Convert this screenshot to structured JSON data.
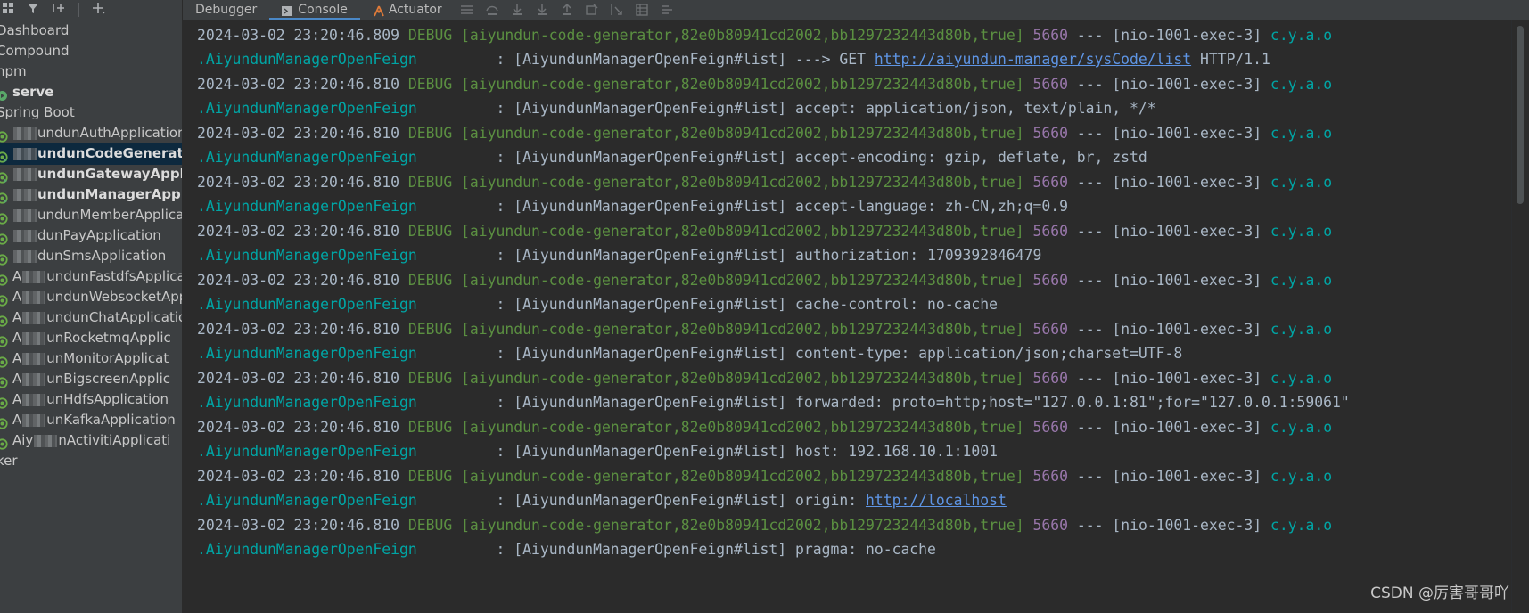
{
  "colors": {
    "timestamp": "#a9b7c6",
    "level": "#5b8f41",
    "pid": "#9876aa",
    "class": "#00a5a5",
    "link": "#5e95e5",
    "selection": "#0d293e",
    "tab_underline": "#4a88c7"
  },
  "sidebar": {
    "toolbar_icons": [
      "group-icon",
      "filter-icon",
      "add-service-icon",
      "add-icon"
    ],
    "items": [
      {
        "label": "Dashboard",
        "blur": "",
        "prefix": "",
        "icon": "none",
        "bold": false,
        "selected": false,
        "indent": 0
      },
      {
        "label": "Compound",
        "blur": "",
        "prefix": "",
        "icon": "none",
        "bold": false,
        "selected": false,
        "indent": 0
      },
      {
        "label": "npm",
        "blur": "",
        "prefix": "",
        "icon": "none",
        "bold": false,
        "selected": false,
        "indent": 0
      },
      {
        "label": "serve",
        "blur": "",
        "prefix": "",
        "icon": "run-icon",
        "bold": true,
        "selected": false,
        "indent": 1
      },
      {
        "label": "Spring Boot",
        "blur": "",
        "prefix": "",
        "icon": "none",
        "bold": false,
        "selected": false,
        "indent": 0
      },
      {
        "label": "undunAuthApplication",
        "prefix": "",
        "icon": "spring-icon",
        "bold": false,
        "selected": false
      },
      {
        "label": "undunCodeGenerator",
        "prefix": "",
        "icon": "spring-run-icon",
        "bold": true,
        "selected": true
      },
      {
        "label": "undunGatewayApplic",
        "prefix": "",
        "icon": "spring-run-icon",
        "bold": true,
        "selected": false
      },
      {
        "label": "undunManagerApplic",
        "prefix": "",
        "icon": "spring-run-icon",
        "bold": true,
        "selected": false
      },
      {
        "label": "undunMemberApplica",
        "prefix": "",
        "icon": "spring-icon",
        "bold": false,
        "selected": false
      },
      {
        "label": "dunPayApplication",
        "prefix": "",
        "icon": "spring-icon",
        "bold": false,
        "selected": false
      },
      {
        "label": "dunSmsApplication",
        "prefix": "",
        "icon": "spring-icon",
        "bold": false,
        "selected": false
      },
      {
        "label": "undunFastdfsApplicatio",
        "prefix": "A",
        "icon": "spring-icon",
        "bold": false,
        "selected": false
      },
      {
        "label": "undunWebsocketAppl",
        "prefix": "A",
        "icon": "spring-icon",
        "bold": false,
        "selected": false
      },
      {
        "label": "undunChatApplication",
        "prefix": "A",
        "icon": "spring-icon",
        "bold": false,
        "selected": false
      },
      {
        "label": "unRocketmqApplic",
        "prefix": "A",
        "icon": "spring-icon",
        "bold": false,
        "selected": false
      },
      {
        "label": "unMonitorApplicat",
        "prefix": "A",
        "icon": "spring-icon",
        "bold": false,
        "selected": false
      },
      {
        "label": "unBigscreenApplic",
        "prefix": "A",
        "icon": "spring-icon",
        "bold": false,
        "selected": false
      },
      {
        "label": "unHdfsApplication",
        "prefix": "A",
        "icon": "spring-icon",
        "bold": false,
        "selected": false
      },
      {
        "label": "unKafkaApplication",
        "prefix": "A",
        "icon": "spring-icon",
        "bold": false,
        "selected": false
      },
      {
        "label": "nActivitiApplicati",
        "prefix": "Aiy",
        "icon": "spring-icon",
        "bold": false,
        "selected": false
      },
      {
        "label": "ker",
        "prefix": "",
        "icon": "none",
        "bold": false,
        "selected": false
      }
    ]
  },
  "topbar": {
    "tabs": [
      {
        "label": "Debugger",
        "icon": "",
        "active": false
      },
      {
        "label": "Console",
        "icon": "console-icon",
        "active": true
      },
      {
        "label": "Actuator",
        "icon": "actuator-icon",
        "active": false
      }
    ],
    "tool_icons": [
      "menu-icon",
      "step-over-icon",
      "step-into-icon",
      "force-step-into-icon",
      "step-out-icon",
      "drop-frame-icon",
      "run-to-cursor-icon",
      "evaluate-icon",
      "trace-icon"
    ]
  },
  "console": {
    "lines": [
      {
        "ts": "2024-03-02 23:20:46.809",
        "level": "DEBUG",
        "group": "[aiyundun-code-generator,82e0b80941cd2002,bb1297232443d80b,true]",
        "pid": "5660",
        "dash": "---",
        "thread": "[nio-1001-exec-3]",
        "cls": "c.y.a.o",
        "cls2": ".AiyundunManagerOpenFeign",
        "msg_prefix": ": [AiyundunManagerOpenFeign#list] ---> GET ",
        "link": "http://aiyundun-manager/sysCode/list",
        "msg_suffix": " HTTP/1.1"
      },
      {
        "ts": "2024-03-02 23:20:46.810",
        "level": "DEBUG",
        "group": "[aiyundun-code-generator,82e0b80941cd2002,bb1297232443d80b,true]",
        "pid": "5660",
        "dash": "---",
        "thread": "[nio-1001-exec-3]",
        "cls": "c.y.a.o",
        "cls2": ".AiyundunManagerOpenFeign",
        "msg_prefix": ": [AiyundunManagerOpenFeign#list] accept: application/json, text/plain, */*",
        "link": "",
        "msg_suffix": ""
      },
      {
        "ts": "2024-03-02 23:20:46.810",
        "level": "DEBUG",
        "group": "[aiyundun-code-generator,82e0b80941cd2002,bb1297232443d80b,true]",
        "pid": "5660",
        "dash": "---",
        "thread": "[nio-1001-exec-3]",
        "cls": "c.y.a.o",
        "cls2": ".AiyundunManagerOpenFeign",
        "msg_prefix": ": [AiyundunManagerOpenFeign#list] accept-encoding: gzip, deflate, br, zstd",
        "link": "",
        "msg_suffix": ""
      },
      {
        "ts": "2024-03-02 23:20:46.810",
        "level": "DEBUG",
        "group": "[aiyundun-code-generator,82e0b80941cd2002,bb1297232443d80b,true]",
        "pid": "5660",
        "dash": "---",
        "thread": "[nio-1001-exec-3]",
        "cls": "c.y.a.o",
        "cls2": ".AiyundunManagerOpenFeign",
        "msg_prefix": ": [AiyundunManagerOpenFeign#list] accept-language: zh-CN,zh;q=0.9",
        "link": "",
        "msg_suffix": ""
      },
      {
        "ts": "2024-03-02 23:20:46.810",
        "level": "DEBUG",
        "group": "[aiyundun-code-generator,82e0b80941cd2002,bb1297232443d80b,true]",
        "pid": "5660",
        "dash": "---",
        "thread": "[nio-1001-exec-3]",
        "cls": "c.y.a.o",
        "cls2": ".AiyundunManagerOpenFeign",
        "msg_prefix": ": [AiyundunManagerOpenFeign#list] authorization: 1709392846479",
        "link": "",
        "msg_suffix": ""
      },
      {
        "ts": "2024-03-02 23:20:46.810",
        "level": "DEBUG",
        "group": "[aiyundun-code-generator,82e0b80941cd2002,bb1297232443d80b,true]",
        "pid": "5660",
        "dash": "---",
        "thread": "[nio-1001-exec-3]",
        "cls": "c.y.a.o",
        "cls2": ".AiyundunManagerOpenFeign",
        "msg_prefix": ": [AiyundunManagerOpenFeign#list] cache-control: no-cache",
        "link": "",
        "msg_suffix": ""
      },
      {
        "ts": "2024-03-02 23:20:46.810",
        "level": "DEBUG",
        "group": "[aiyundun-code-generator,82e0b80941cd2002,bb1297232443d80b,true]",
        "pid": "5660",
        "dash": "---",
        "thread": "[nio-1001-exec-3]",
        "cls": "c.y.a.o",
        "cls2": ".AiyundunManagerOpenFeign",
        "msg_prefix": ": [AiyundunManagerOpenFeign#list] content-type: application/json;charset=UTF-8",
        "link": "",
        "msg_suffix": ""
      },
      {
        "ts": "2024-03-02 23:20:46.810",
        "level": "DEBUG",
        "group": "[aiyundun-code-generator,82e0b80941cd2002,bb1297232443d80b,true]",
        "pid": "5660",
        "dash": "---",
        "thread": "[nio-1001-exec-3]",
        "cls": "c.y.a.o",
        "cls2": ".AiyundunManagerOpenFeign",
        "msg_prefix": ": [AiyundunManagerOpenFeign#list] forwarded: proto=http;host=\"127.0.0.1:81\";for=\"127.0.0.1:59061\"",
        "link": "",
        "msg_suffix": ""
      },
      {
        "ts": "2024-03-02 23:20:46.810",
        "level": "DEBUG",
        "group": "[aiyundun-code-generator,82e0b80941cd2002,bb1297232443d80b,true]",
        "pid": "5660",
        "dash": "---",
        "thread": "[nio-1001-exec-3]",
        "cls": "c.y.a.o",
        "cls2": ".AiyundunManagerOpenFeign",
        "msg_prefix": ": [AiyundunManagerOpenFeign#list] host: 192.168.10.1:1001",
        "link": "",
        "msg_suffix": ""
      },
      {
        "ts": "2024-03-02 23:20:46.810",
        "level": "DEBUG",
        "group": "[aiyundun-code-generator,82e0b80941cd2002,bb1297232443d80b,true]",
        "pid": "5660",
        "dash": "---",
        "thread": "[nio-1001-exec-3]",
        "cls": "c.y.a.o",
        "cls2": ".AiyundunManagerOpenFeign",
        "msg_prefix": ": [AiyundunManagerOpenFeign#list] origin: ",
        "link": "http://localhost",
        "msg_suffix": ""
      },
      {
        "ts": "2024-03-02 23:20:46.810",
        "level": "DEBUG",
        "group": "[aiyundun-code-generator,82e0b80941cd2002,bb1297232443d80b,true]",
        "pid": "5660",
        "dash": "---",
        "thread": "[nio-1001-exec-3]",
        "cls": "c.y.a.o",
        "cls2": ".AiyundunManagerOpenFeign",
        "msg_prefix": ": [AiyundunManagerOpenFeign#list] pragma: no-cache",
        "link": "",
        "msg_suffix": ""
      }
    ]
  },
  "watermark": "CSDN @厉害哥哥吖"
}
